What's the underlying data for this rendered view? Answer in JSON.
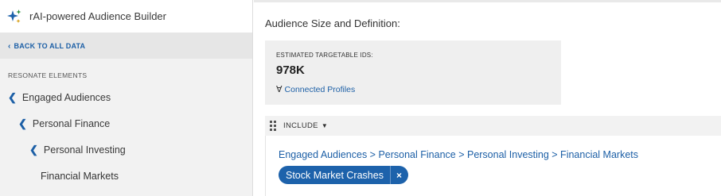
{
  "sidebar": {
    "header_title": "rAI-powered Audience Builder",
    "header_icon": "sparkle-icon",
    "back_label": "BACK TO ALL DATA",
    "section_label": "RESONATE ELEMENTS",
    "nav": [
      {
        "label": "Engaged Audiences"
      },
      {
        "label": "Personal Finance"
      },
      {
        "label": "Personal Investing"
      },
      {
        "label": "Financial Markets"
      }
    ],
    "chevron_glyph": "‹"
  },
  "main": {
    "title": "Audience Size and Definition:",
    "estimate": {
      "label": "ESTIMATED TARGETABLE IDS:",
      "value": "978K",
      "connected_label": "Connected Profiles"
    },
    "include_label": "INCLUDE",
    "breadcrumb": "Engaged Audiences > Personal Finance > Personal Investing > Financial Markets",
    "tag_label": "Stock Market Crashes",
    "tag_remove": "×"
  },
  "colors": {
    "accent": "#1c5fa6",
    "tag_bg": "#1d62ab",
    "sidebar_bg": "#f2f2f2"
  }
}
